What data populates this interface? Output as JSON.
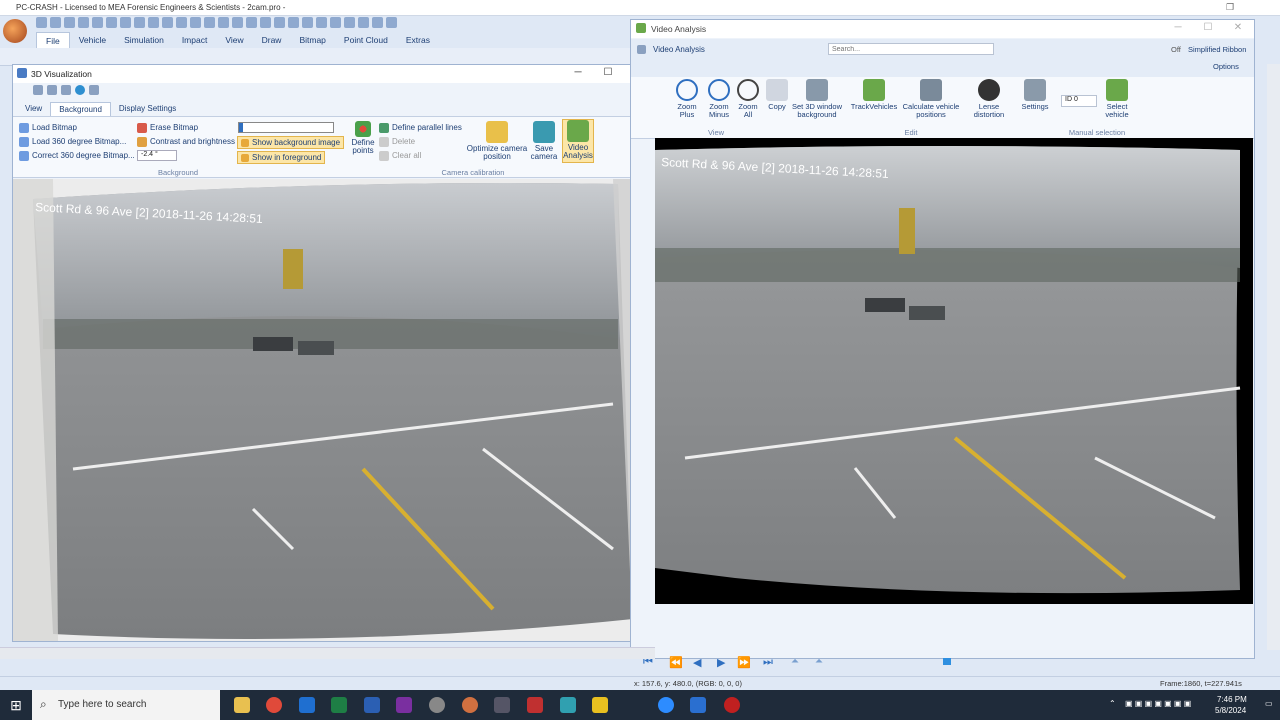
{
  "app": {
    "title": "PC-CRASH - Licensed to MEA Forensic Engineers & Scientists - 2cam.pro -",
    "menu": [
      "File",
      "Vehicle",
      "Simulation",
      "Impact",
      "View",
      "Draw",
      "Bitmap",
      "Point Cloud",
      "Extras"
    ]
  },
  "win3d": {
    "title": "3D Visualization",
    "tabs": [
      "View",
      "Background",
      "Display Settings"
    ],
    "buttons": {
      "load_bitmap": "Load Bitmap",
      "load_360": "Load 360 degree Bitmap...",
      "correct_360": "Correct 360 degree Bitmap...",
      "erase_bitmap": "Erase Bitmap",
      "contrast": "Contrast and brightness",
      "angle_value": "-2.4 °",
      "show_bg_image": "Show background image",
      "show_foreground": "Show in foreground",
      "define_points": "Define points",
      "define_parallel": "Define parallel lines",
      "delete": "Delete",
      "clear_all": "Clear all",
      "optimize": "Optimize camera position",
      "save_camera": "Save camera",
      "video_analysis": "Video Analysis"
    },
    "groups": {
      "background": "Background",
      "camera_calibration": "Camera calibration"
    },
    "overlay_text": "Scott Rd & 96 Ave [2] 2018-11-26 14:28:51"
  },
  "winva": {
    "title": "Video Analysis",
    "qat_label": "Video Analysis",
    "search_placeholder": "Search...",
    "off_label": "Off",
    "simplified": "Simplified Ribbon",
    "options": "Options",
    "buttons": [
      "Zoom Plus",
      "Zoom Minus",
      "Zoom All",
      "Copy",
      "Set 3D window background",
      "TrackVehicles",
      "Calculate vehicle positions",
      "Lense distortion",
      "Settings"
    ],
    "id_value": "ID 0",
    "select_vehicle": "Select vehicle",
    "groups": {
      "view": "View",
      "edit": "Edit",
      "manual": "Manual selection"
    },
    "overlay_text": "Scott Rd & 96 Ave [2] 2018-11-26 14:28:51"
  },
  "status": {
    "coords": "x: 157.6, y: 480.0, (RGB: 0, 0, 0)",
    "frame": "Frame:1860, t=227.941s"
  },
  "taskbar": {
    "search": "Type here to search",
    "time": "7:46 PM",
    "date": "5/8/2024"
  }
}
